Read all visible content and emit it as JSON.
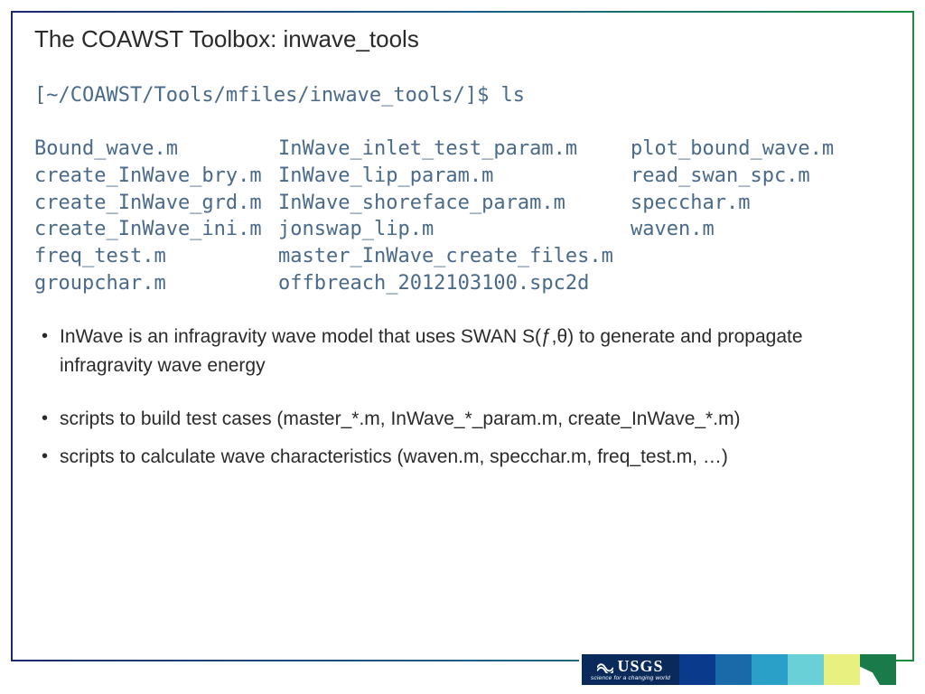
{
  "title": "The COAWST Toolbox: inwave_tools",
  "terminal": {
    "prompt": "[~/COAWST/Tools/mfiles/inwave_tools/]$ ls",
    "col1": [
      "Bound_wave.m",
      "create_InWave_bry.m",
      "create_InWave_grd.m",
      "create_InWave_ini.m",
      "freq_test.m",
      "groupchar.m"
    ],
    "col2": [
      "InWave_inlet_test_param.m",
      "InWave_lip_param.m",
      "InWave_shoreface_param.m",
      "jonswap_lip.m",
      "master_InWave_create_files.m",
      "offbreach_2012103100.spc2d"
    ],
    "col3": [
      "plot_bound_wave.m",
      "read_swan_spc.m",
      "specchar.m",
      "waven.m",
      "",
      ""
    ]
  },
  "bullets": {
    "b1": "InWave is an infragravity wave model that uses SWAN S(ƒ,θ) to generate and propagate infragravity wave energy",
    "b2": "scripts to build test cases (master_*.m, InWave_*_param.m, create_InWave_*.m)",
    "b3": "scripts to calculate wave characteristics (waven.m, specchar.m, freq_test.m, …)"
  },
  "footer": {
    "usgs_main": "USGS",
    "usgs_sub": "science for a changing world"
  }
}
